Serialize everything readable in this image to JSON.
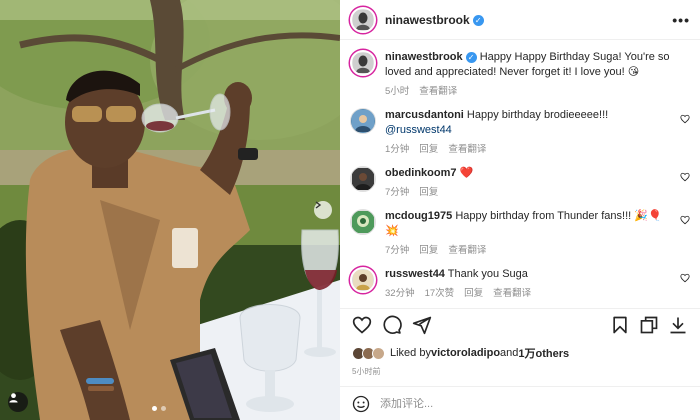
{
  "post": {
    "author": "ninawestbrook",
    "verified": true
  },
  "comments": [
    {
      "user": "ninawestbrook",
      "verified": true,
      "text": "Happy Happy Birthday Suga! You're so loved and appreciated! Never forget it! I love you! 😘",
      "time": "5小时",
      "translate": "查看翻译",
      "avatar_color": "#9aa0a6"
    },
    {
      "user": "marcusdantoni",
      "text": "Happy birthday brodieeeee!!! ",
      "mention": "@russwest44",
      "time": "1分钟",
      "reply": "回复",
      "translate": "查看翻译",
      "avatar_color": "#5a8fb8"
    },
    {
      "user": "obedinkoom7",
      "text": "❤️",
      "time": "7分钟",
      "reply": "回复",
      "avatar_color": "#3c3c3c"
    },
    {
      "user": "mcdoug1975",
      "text": "Happy birthday from Thunder fans!!! 🎉🎈💥",
      "time": "7分钟",
      "reply": "回复",
      "translate": "查看翻译",
      "avatar_color": "#4e9a5b"
    },
    {
      "user": "russwest44",
      "text": "Thank you Suga",
      "time": "32分钟",
      "likes": "17次赞",
      "reply": "回复",
      "translate": "查看翻译",
      "avatar_color": "#c9a24a"
    }
  ],
  "likes": {
    "prefix": "Liked by ",
    "user": "victoroladipo",
    "and": "and",
    "others": "1万others"
  },
  "post_time": "5小时前",
  "add_comment": {
    "placeholder": "添加评论..."
  },
  "colors": {
    "verified": "#3897f0",
    "mention": "#00376b",
    "meta": "#8e8e8e"
  },
  "icons": [
    "more-options-icon",
    "heart-icon",
    "comment-icon",
    "share-icon",
    "bookmark-icon",
    "copy-icon",
    "download-icon",
    "emoji-icon",
    "chevron-right-icon",
    "user-tag-icon"
  ]
}
